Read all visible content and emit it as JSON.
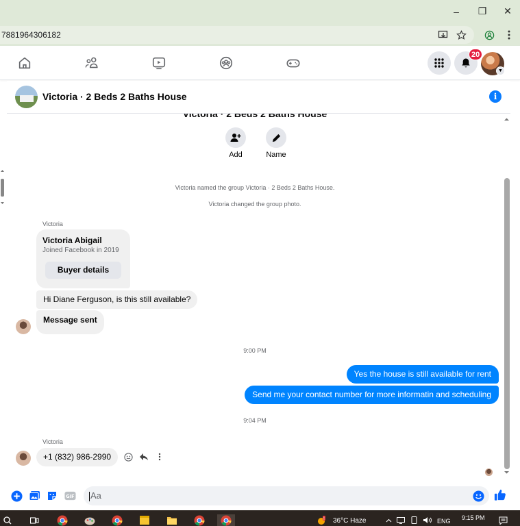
{
  "browser": {
    "url_fragment": "7881964306182",
    "window_buttons": {
      "minimize": "–",
      "restore": "❐",
      "close": "✕"
    }
  },
  "fb_nav": {
    "notification_count": "20"
  },
  "chat": {
    "title": "Victoria · 2 Beds 2 Baths House",
    "cut_title": "Victoria · 2 Beds 2 Baths House",
    "actions": [
      {
        "label": "Add"
      },
      {
        "label": "Name"
      }
    ],
    "system_messages": [
      "Victoria named the group Victoria · 2 Beds 2 Baths House.",
      "Victoria changed the group photo."
    ],
    "sender_1": "Victoria",
    "card": {
      "name": "Victoria Abigail",
      "subtitle": "Joined Facebook in 2019",
      "button": "Buyer details"
    },
    "incoming_1": "Hi Diane Ferguson, is this still available?",
    "incoming_2": "Message sent",
    "time_1": "9:00 PM",
    "outgoing_1": "Yes the house is still available for rent",
    "outgoing_2": "Send me your contact number for more informatin and  scheduling",
    "time_2": "9:04 PM",
    "sender_2": "Victoria",
    "incoming_3": "+1 (832) 986-2990",
    "composer_placeholder": "Aa"
  },
  "taskbar": {
    "weather": "36°C  Haze",
    "lang": "ENG",
    "time": "9:15 PM"
  },
  "colors": {
    "messenger_blue": "#0084ff",
    "fb_blue": "#0866ff",
    "badge_red": "#e41e3f",
    "chrome_green": "#dfe9d8"
  }
}
